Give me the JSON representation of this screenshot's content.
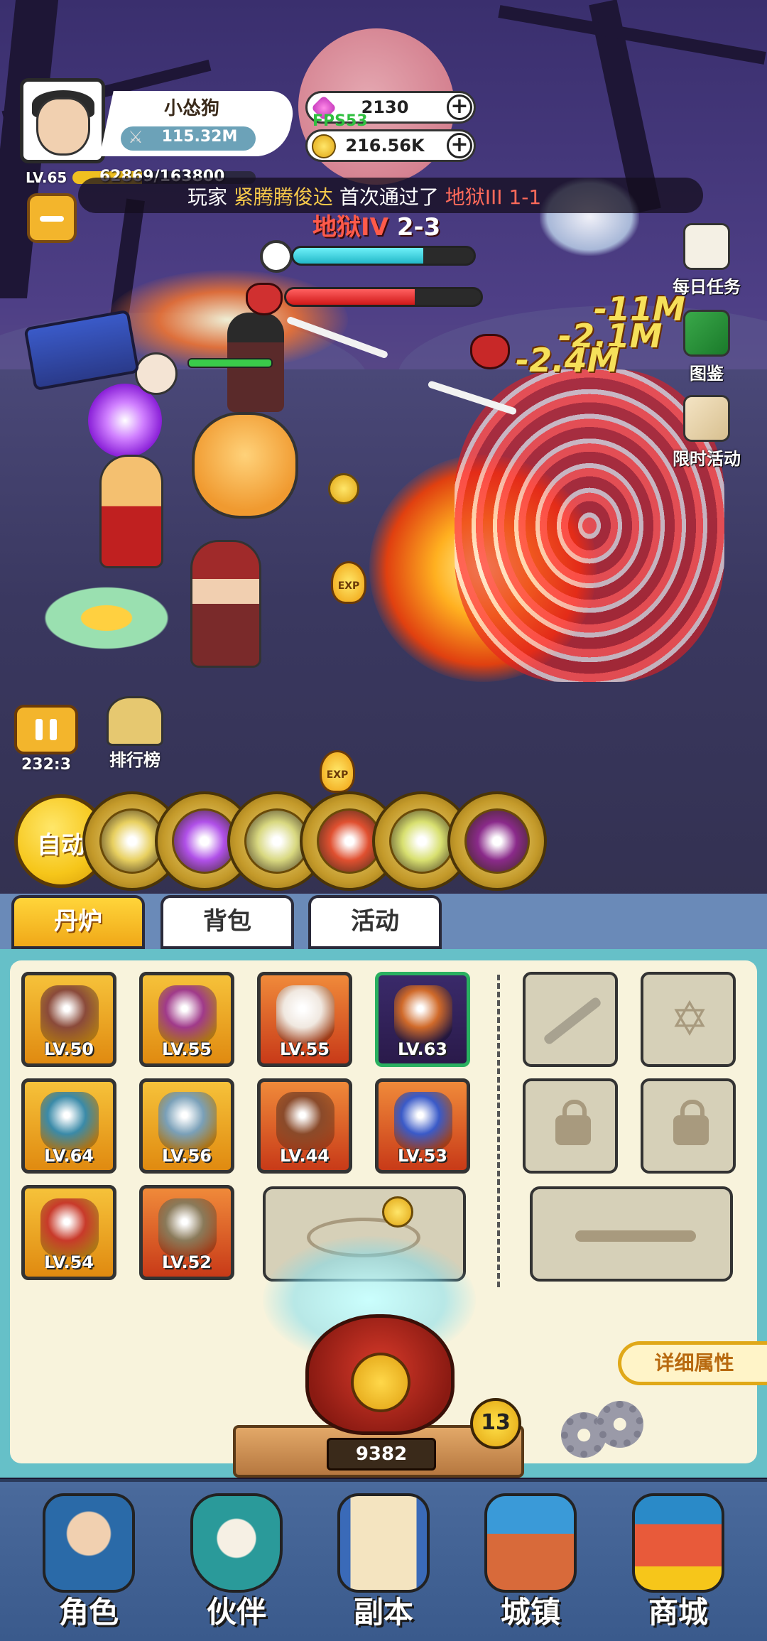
{
  "player": {
    "name": "小怂狗",
    "power": "115.32M",
    "level": "LV.65",
    "xp_text": "62869/163800",
    "xp_fraction": 0.38
  },
  "currency": {
    "gems": "2130",
    "gold": "216.56K",
    "fps": "FPS53"
  },
  "broadcast": {
    "prefix": "玩家",
    "player": "紧腾腾俊达",
    "middle": "首次通过了",
    "stage": "地狱III 1-1"
  },
  "stage": {
    "name": "地狱IV",
    "number": "2-3",
    "progress_fraction": 0.72,
    "boss_hp_fraction": 0.66
  },
  "side_buttons": {
    "daily": "每日任务",
    "codex": "图鉴",
    "event": "限时活动"
  },
  "damage_numbers": [
    "-11M",
    "-2.1M",
    "-2.4M"
  ],
  "exp_tag": "EXP",
  "controls": {
    "pause_timer": "232:3",
    "rank_label": "排行榜",
    "auto_label": "自动"
  },
  "skills": [
    {
      "name": "golden-pillars",
      "color": "#e8d060"
    },
    {
      "name": "purple-orb",
      "color": "#b050e8"
    },
    {
      "name": "yellow-rune",
      "color": "#d8d880"
    },
    {
      "name": "red-whirlwind",
      "color": "#e05030"
    },
    {
      "name": "comet",
      "color": "#d8e070"
    },
    {
      "name": "dark-vortex",
      "color": "#8a2a8a"
    }
  ],
  "tabs": [
    "丹炉",
    "背包",
    "活动"
  ],
  "equipment": [
    {
      "level": "LV.50",
      "frame": "gold",
      "item": "dagger",
      "color": "#8a4a3a"
    },
    {
      "level": "LV.55",
      "frame": "gold",
      "item": "crown",
      "color": "#a03a8a"
    },
    {
      "level": "LV.55",
      "frame": "red",
      "item": "robe",
      "color": "#f0e8e0"
    },
    {
      "level": "LV.63",
      "frame": "green",
      "item": "orb",
      "color": "#d06a2a"
    },
    {
      "level": "LV.64",
      "frame": "gold",
      "item": "necklace",
      "color": "#3a8aa8"
    },
    {
      "level": "LV.56",
      "frame": "gold",
      "item": "shield",
      "color": "#7aa0b8"
    },
    {
      "level": "LV.44",
      "frame": "red",
      "item": "bracer",
      "color": "#8a4a2a"
    },
    {
      "level": "LV.53",
      "frame": "red",
      "item": "amulet",
      "color": "#3a5ac8"
    },
    {
      "level": "LV.54",
      "frame": "gold",
      "item": "scarf",
      "color": "#c83a2a"
    },
    {
      "level": "LV.52",
      "frame": "red",
      "item": "boots",
      "color": "#8a7a5a"
    }
  ],
  "detail_button": "详细属性",
  "cauldron": {
    "count": "9382",
    "level": "13"
  },
  "nav": [
    "角色",
    "伙伴",
    "副本",
    "城镇",
    "商城"
  ],
  "colors": {
    "accent_gold": "#f6c61a",
    "panel": "#f8f3dc",
    "panel_border": "#66c0c8",
    "nav_bg": "#3a5a8c"
  }
}
